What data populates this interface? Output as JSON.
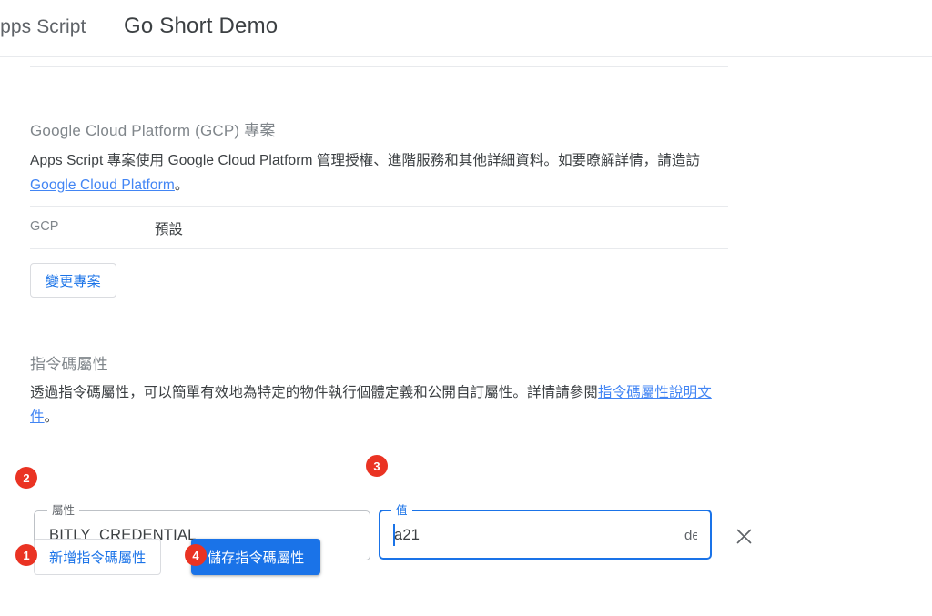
{
  "header": {
    "brand": "Apps Script",
    "project_title": "Go Short Demo"
  },
  "gcp_section": {
    "title": "Google Cloud Platform (GCP) 專案",
    "description_part1": "Apps Script 專案使用 Google Cloud Platform 管理授權、進階服務和其他詳細資料。如要瞭解詳情，請造訪 ",
    "description_link": "Google Cloud Platform",
    "description_part2": "。",
    "row_key": "GCP",
    "row_value": "預設",
    "change_button": "變更專案"
  },
  "script_properties_section": {
    "title": "指令碼屬性",
    "description_part1": "透過指令碼屬性，可以簡單有效地為特定的物件執行個體定義和公開自訂屬性。詳情請參閱",
    "description_link": "指令碼屬性說明文件",
    "description_part2": "。",
    "property_field": {
      "label": "屬性",
      "value": "BITLY_CREDENTIAL"
    },
    "value_field": {
      "label": "值",
      "value": "a21",
      "value_tail": "de"
    },
    "remove_icon": "close-icon",
    "add_button": "新增指令碼屬性",
    "save_button": "儲存指令碼屬性"
  },
  "step_badges": [
    {
      "number": "1",
      "target": "add-script-property-button"
    },
    {
      "number": "2",
      "target": "property-name-field"
    },
    {
      "number": "3",
      "target": "property-value-field"
    },
    {
      "number": "4",
      "target": "save-script-properties-button"
    }
  ],
  "colors": {
    "accent_blue": "#1a73e8",
    "link_blue": "#4285f4",
    "badge_red": "#ea3323",
    "text_primary": "#3c4043",
    "text_secondary": "#80868b",
    "divider": "#e8eaed"
  }
}
